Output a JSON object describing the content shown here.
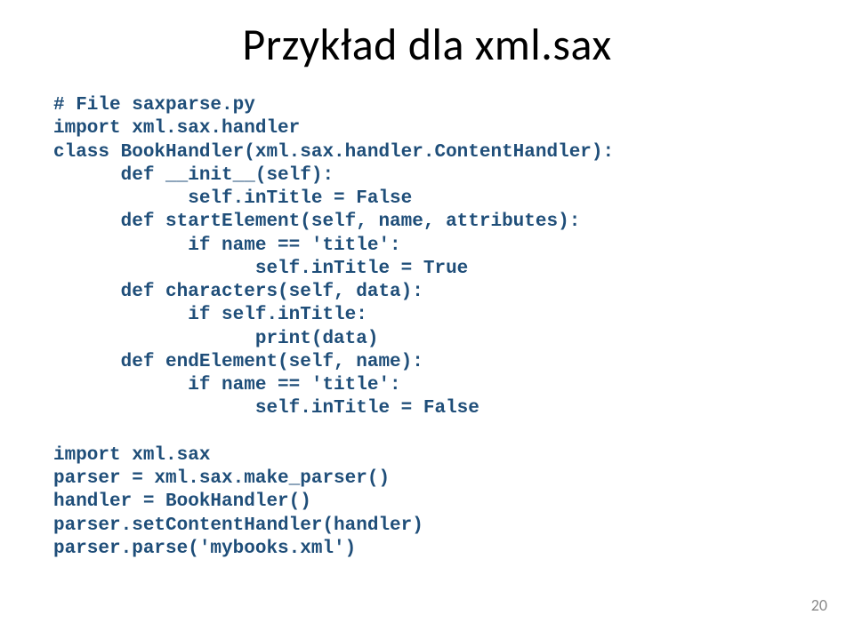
{
  "title": "Przykład dla xml.sax",
  "code": {
    "l01": "# File saxparse.py",
    "l02": "import xml.sax.handler",
    "l03": "class BookHandler(xml.sax.handler.ContentHandler):",
    "l04": "      def __init__(self):",
    "l05": "            self.inTitle = False",
    "l06": "      def startElement(self, name, attributes):",
    "l07": "            if name == 'title':",
    "l08": "                  self.inTitle = True",
    "l09": "      def characters(self, data):",
    "l10": "            if self.inTitle:",
    "l11": "                  print(data)",
    "l12": "      def endElement(self, name):",
    "l13": "            if name == 'title':",
    "l14": "                  self.inTitle = False",
    "l15": "",
    "l16": "import xml.sax",
    "l17": "parser = xml.sax.make_parser()",
    "l18": "handler = BookHandler()",
    "l19": "parser.setContentHandler(handler)",
    "l20": "parser.parse('mybooks.xml')"
  },
  "page_number": "20"
}
